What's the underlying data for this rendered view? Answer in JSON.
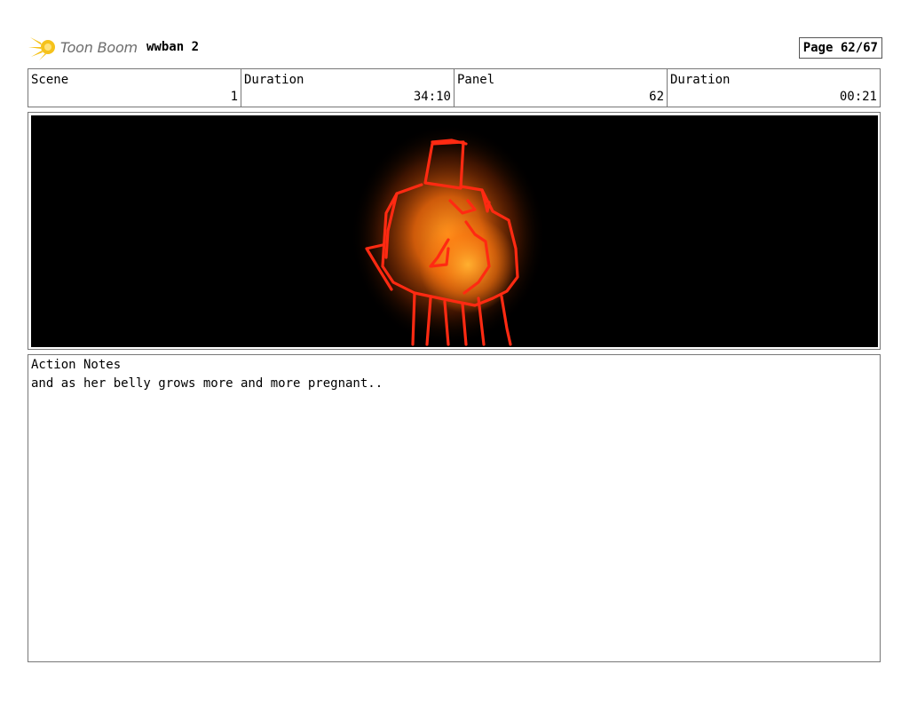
{
  "header": {
    "brand": "Toon Boom",
    "project": "wwban 2",
    "page": "Page 62/67"
  },
  "info": {
    "scene_label": "Scene",
    "scene_value": "1",
    "scene_duration_label": "Duration",
    "scene_duration_value": "34:10",
    "panel_label": "Panel",
    "panel_value": "62",
    "panel_duration_label": "Duration",
    "panel_duration_value": "00:21"
  },
  "notes": {
    "title": "Action Notes",
    "text": "and as her belly grows more and more pregnant.."
  },
  "colors": {
    "sketch_line": "#ff2a12",
    "glow_core": "#ff8a1a",
    "background": "#000000"
  }
}
